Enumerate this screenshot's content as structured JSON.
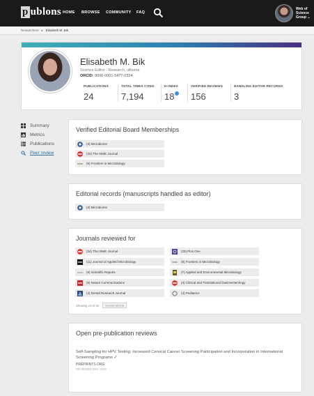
{
  "nav": {
    "logo": "publons",
    "items": [
      "HOME",
      "BROWSE",
      "COMMUNITY",
      "FAQ"
    ],
    "wos_label": [
      "Web of",
      "Science",
      "Group ⌄"
    ]
  },
  "breadcrumb": {
    "root": "Researchers",
    "separator": "▸",
    "current": "Elisabeth M. Bik"
  },
  "profile": {
    "name": "Elisabeth M. Bik",
    "subtitle": "Science Editor - Research, uBiome",
    "orcid_label": "ORCID:",
    "orcid": "0000-0001-5477-0324",
    "stats": [
      {
        "label": "PUBLICATIONS",
        "value": "24"
      },
      {
        "label": "TOTAL TIMES CITED",
        "value": "7,194"
      },
      {
        "label": "H-INDEX",
        "value": "18"
      },
      {
        "label": "VERIFIED REVIEWS",
        "value": "156"
      },
      {
        "label": "HANDLING EDITOR RECORDS",
        "value": "3"
      }
    ]
  },
  "sidebar": {
    "items": [
      "Summary",
      "Metrics",
      "Publications",
      "Peer review"
    ]
  },
  "editorial_board": {
    "title": "Verified Editorial Board Memberships",
    "items": [
      "(3) Microbiome",
      "(34) The ISME Journal",
      "(9) Frontiers in Microbiology"
    ]
  },
  "editorial_records": {
    "title": "Editorial records (manuscripts handled as editor)",
    "items": [
      "(3) Microbiome"
    ]
  },
  "journals_reviewed": {
    "title": "Journals reviewed for",
    "left": [
      "(34) The ISME Journal",
      "(11) Journal of Applied Microbiology",
      "(8) Scientific Reports",
      "(5) Nature Communications",
      "(4) Dental Research Journal"
    ],
    "right": [
      "(20) Plos One",
      "(9) Frontiers in Microbiology",
      "(7) Applied and Environmental Microbiology",
      "(4) Clinical and Translational Gastroenterology",
      "(4) Pediatrics"
    ],
    "showing": "Showing 10 of 42",
    "show_more": "SHOW MORE"
  },
  "open_reviews": {
    "title": "Open pre-publication reviews",
    "review_title": "Self-Sampling for HPV Testing: Increased Cervical Cancer Screening Participation and Incorporation in International Screening Programs",
    "check": "✓",
    "source": "PREPRINTS.ORG",
    "date": "REVIEWED MAY 2018"
  }
}
